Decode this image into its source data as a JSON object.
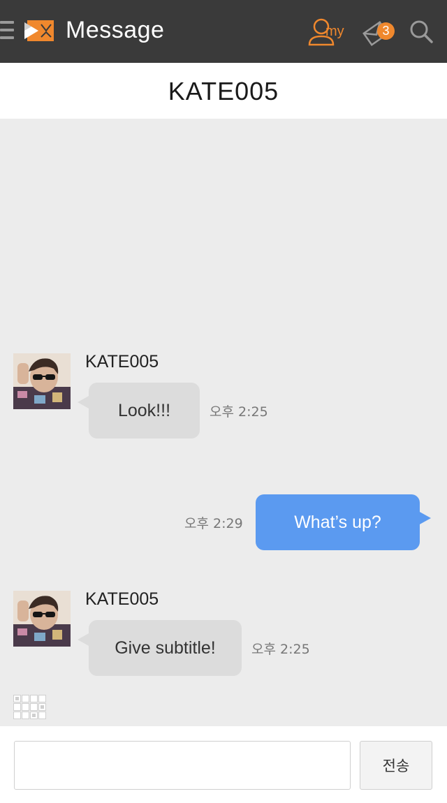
{
  "topbar": {
    "title": "Message",
    "my_label": "my",
    "unread_count": "3",
    "accent_color": "#f0882d",
    "icons": [
      "menu-icon",
      "app-logo",
      "my-profile-icon",
      "mail-icon",
      "search-icon"
    ]
  },
  "chat": {
    "partner_name": "KATE005",
    "messages": [
      {
        "direction": "in",
        "sender": "KATE005",
        "text": "Look!!!",
        "time": "오후 2:25"
      },
      {
        "direction": "out",
        "text": "What’s up?",
        "time": "오후 2:29"
      },
      {
        "direction": "in",
        "sender": "KATE005",
        "text": "Give subtitle!",
        "time": "오후 2:25"
      }
    ],
    "outgoing_bubble_color": "#5b9af0",
    "incoming_bubble_color": "#dcdcdc"
  },
  "composer": {
    "input_value": "",
    "send_label": "전송"
  }
}
